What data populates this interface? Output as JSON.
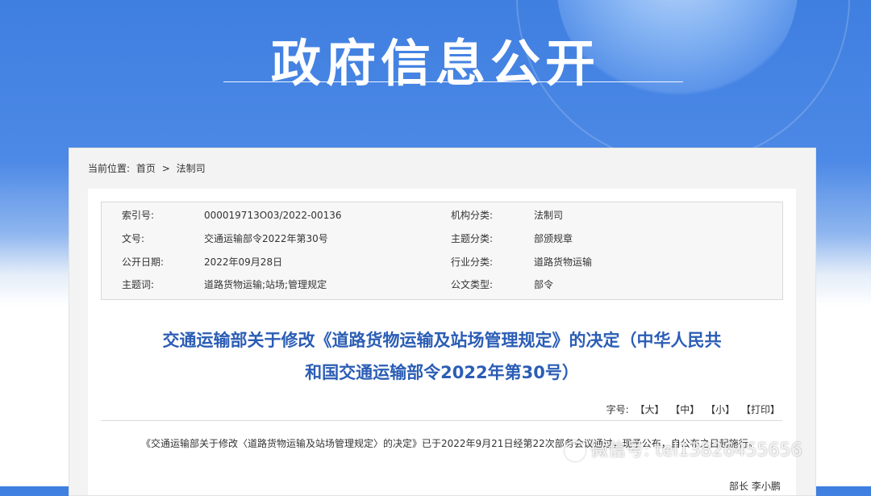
{
  "banner": {
    "title": "政府信息公开"
  },
  "breadcrumb": {
    "label": "当前位置:",
    "home": "首页",
    "sep": ">",
    "current": "法制司"
  },
  "meta": {
    "rows": [
      {
        "k1": "索引号:",
        "v1": "000019713O03/2022-00136",
        "k2": "机构分类:",
        "v2": "法制司"
      },
      {
        "k1": "文号:",
        "v1": "交通运输部令2022年第30号",
        "k2": "主题分类:",
        "v2": "部颁规章"
      },
      {
        "k1": "公开日期:",
        "v1": "2022年09月28日",
        "k2": "行业分类:",
        "v2": "道路货物运输"
      },
      {
        "k1": "主题词:",
        "v1": "道路货物运输;站场;管理规定",
        "k2": "公文类型:",
        "v2": "部令"
      }
    ]
  },
  "document": {
    "title_line1": "交通运输部关于修改《道路货物运输及站场管理规定》的决定（中华人民共",
    "title_line2": "和国交通运输部令2022年第30号）",
    "font_size_label": "字号:",
    "font_large": "【大】",
    "font_medium": "【中】",
    "font_small": "【小】",
    "print": "【打印】",
    "body": "《交通运输部关于修改〈道路货物运输及站场管理规定〉的决定》已于2022年9月21日经第22次部务会议通过，现予公布，自公布之日起施行。",
    "signature": "部长 李小鹏"
  },
  "watermark": {
    "text": "微信号: tel13826455656"
  }
}
